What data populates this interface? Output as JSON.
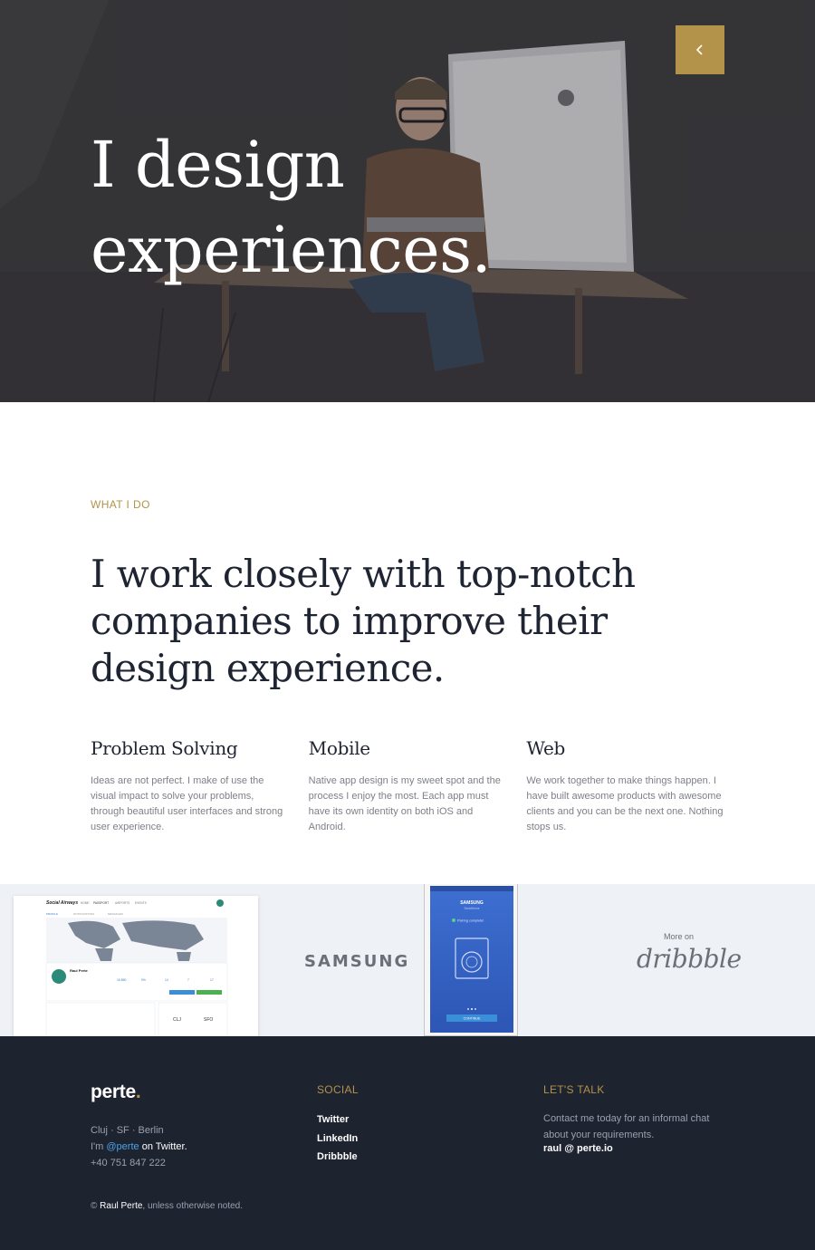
{
  "hero": {
    "title_line1": "I design",
    "title_line2": "experiences.",
    "back_icon": "chevron-left-icon",
    "accent": "#b3924a"
  },
  "what_i_do": {
    "eyebrow": "WHAT I DO",
    "lead_line1": "I work closely with top-notch",
    "lead_line2": "companies to improve their",
    "lead_line3": "design experience.",
    "services": [
      {
        "title": "Problem Solving",
        "text": "Ideas are not perfect. I make of use the visual impact to solve your problems, through beautiful user interfaces and strong user experience."
      },
      {
        "title": "Mobile",
        "text": "Native app design is my sweet spot and the process I enjoy the most. Each app must have its own identity on both iOS and Android."
      },
      {
        "title": "Web",
        "text": "We work together to make things happen. I have built awesome products with awesome clients and you can be the next one. Nothing stops us."
      }
    ]
  },
  "work": {
    "social_app": {
      "logo": "Social Airways",
      "nav": [
        "HOME",
        "PASSPORT",
        "AIRPORTS",
        "EVENTS"
      ],
      "tabs": [
        "PROFILE",
        "NOTIFICATIONS",
        "MESSAGES"
      ],
      "profile_name": "Raul Perte",
      "stats": [
        "16.850",
        "0%",
        "14",
        "7",
        "17"
      ],
      "from_code": "CLJ",
      "to_code": "SFO"
    },
    "samsung_label": "SAMSUNG",
    "phone": {
      "brand": "SAMSUNG",
      "subbrand": "SmartHome",
      "status": "Pairing complete!",
      "button": "CONTINUE"
    },
    "more_on": "More on",
    "dribbble": "dribbble"
  },
  "footer": {
    "brand": "perte",
    "brand_dot": ".",
    "location": "Cluj · SF · Berlin",
    "twitter_prefix": "I'm ",
    "twitter_handle": "@perte",
    "twitter_suffix": " on Twitter.",
    "phone": "+40 751 847 222",
    "social_heading": "SOCIAL",
    "social_links": [
      "Twitter",
      "LinkedIn",
      "Dribbble"
    ],
    "talk_heading": "LET'S TALK",
    "talk_text": "Contact me today for an informal chat about your requirements.",
    "email": "raul @ perte.io",
    "copyright_prefix": "© ",
    "copyright_owner": "Raul Perte",
    "copyright_suffix": ", unless otherwise noted."
  }
}
